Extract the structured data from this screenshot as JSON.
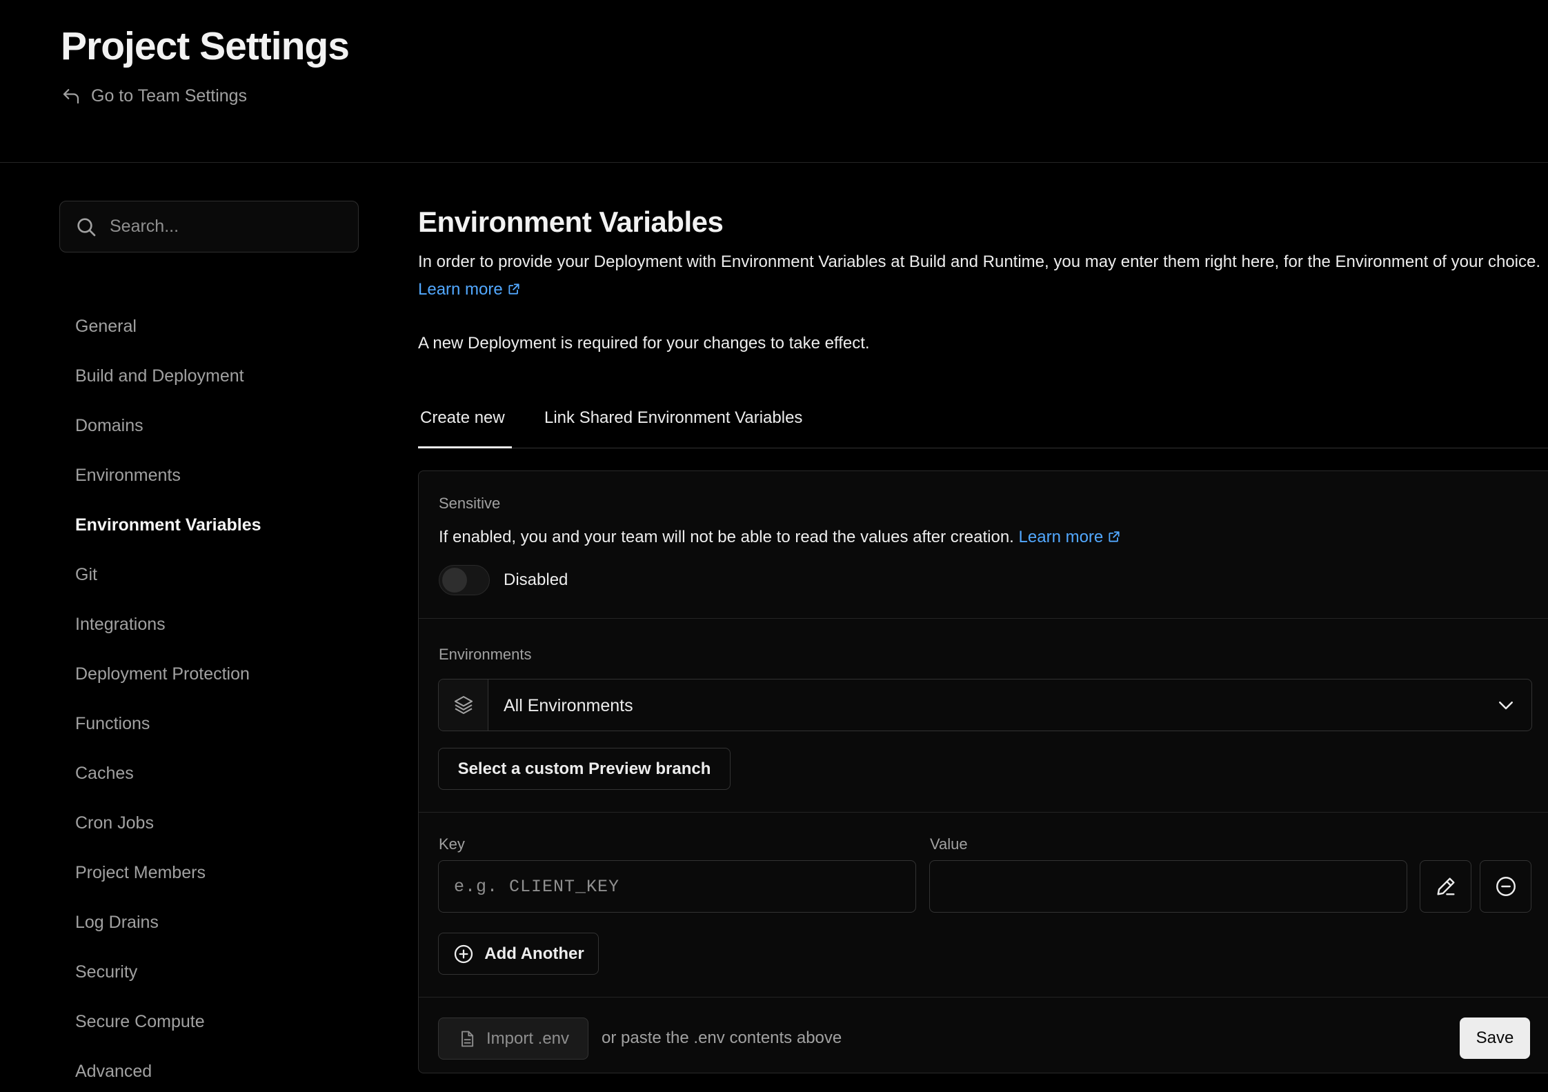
{
  "header": {
    "title": "Project Settings",
    "back_label": "Go to Team Settings"
  },
  "sidebar": {
    "search_placeholder": "Search...",
    "items": [
      {
        "label": "General"
      },
      {
        "label": "Build and Deployment"
      },
      {
        "label": "Domains"
      },
      {
        "label": "Environments"
      },
      {
        "label": "Environment Variables",
        "active": true
      },
      {
        "label": "Git"
      },
      {
        "label": "Integrations"
      },
      {
        "label": "Deployment Protection"
      },
      {
        "label": "Functions"
      },
      {
        "label": "Caches"
      },
      {
        "label": "Cron Jobs"
      },
      {
        "label": "Project Members"
      },
      {
        "label": "Log Drains"
      },
      {
        "label": "Security"
      },
      {
        "label": "Secure Compute"
      },
      {
        "label": "Advanced"
      }
    ]
  },
  "main": {
    "title": "Environment Variables",
    "description": "In order to provide your Deployment with Environment Variables at Build and Runtime, you may enter them right here, for the Environment of your choice.",
    "learn_more": "Learn more",
    "note": "A new Deployment is required for your changes to take effect.",
    "tabs": [
      {
        "label": "Create new",
        "active": true
      },
      {
        "label": "Link Shared Environment Variables"
      }
    ],
    "sensitive": {
      "label": "Sensitive",
      "text": "If enabled, you and your team will not be able to read the values after creation.",
      "learn_more": "Learn more",
      "toggle_state": "Disabled"
    },
    "environments": {
      "label": "Environments",
      "selected": "All Environments",
      "preview_button": "Select a custom Preview branch"
    },
    "vars": {
      "key_label": "Key",
      "value_label": "Value",
      "key_placeholder": "e.g. CLIENT_KEY",
      "value_value": "",
      "add_label": "Add Another"
    },
    "footer": {
      "import_label": "Import .env",
      "paste_text": "or paste the .env contents above",
      "save_label": "Save"
    }
  },
  "colors": {
    "background": "#000000",
    "link": "#52a8ff",
    "text": "#ededed",
    "muted": "#a1a1a1"
  }
}
